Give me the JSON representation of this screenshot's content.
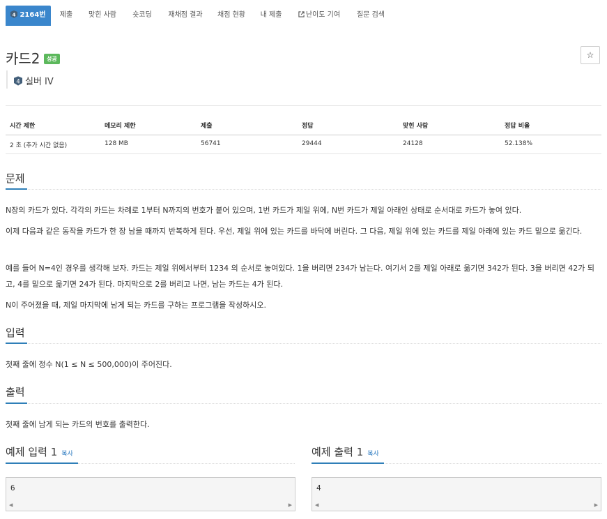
{
  "nav": {
    "problem_tab": "2164번",
    "tabs": [
      "제출",
      "맞힌 사람",
      "숏코딩",
      "재채점 결과",
      "채점 현황",
      "내 제출",
      "난이도 기여",
      "질문 검색"
    ]
  },
  "problem": {
    "title": "카드2",
    "status_badge": "성공",
    "star_icon": "☆",
    "tier": "실버 IV",
    "tier_number": "4"
  },
  "stats": {
    "headers": [
      "시간 제한",
      "메모리 제한",
      "제출",
      "정답",
      "맞힌 사람",
      "정답 비율"
    ],
    "values": [
      "2 초 (추가 시간 없음)",
      "128 MB",
      "56741",
      "29444",
      "24128",
      "52.138%"
    ]
  },
  "sections": {
    "problem_heading": "문제",
    "problem_p1": "N장의 카드가 있다. 각각의 카드는 차례로 1부터 N까지의 번호가 붙어 있으며, 1번 카드가 제일 위에, N번 카드가 제일 아래인 상태로 순서대로 카드가 놓여 있다.",
    "problem_p2": "이제 다음과 같은 동작을 카드가 한 장 남을 때까지 반복하게 된다. 우선, 제일 위에 있는 카드를 바닥에 버린다. 그 다음, 제일 위에 있는 카드를 제일 아래에 있는 카드 밑으로 옮긴다.",
    "problem_p3": "예를 들어 N=4인 경우를 생각해 보자. 카드는 제일 위에서부터 1234 의 순서로 놓여있다. 1을 버리면 234가 남는다. 여기서 2를 제일 아래로 옮기면 342가 된다. 3을 버리면 42가 되고, 4를 밑으로 옮기면 24가 된다. 마지막으로 2를 버리고 나면, 남는 카드는 4가 된다.",
    "problem_p4": "N이 주어졌을 때, 제일 마지막에 남게 되는 카드를 구하는 프로그램을 작성하시오.",
    "input_heading": "입력",
    "input_text": "첫째 줄에 정수 N(1 ≤ N ≤ 500,000)이 주어진다.",
    "output_heading": "출력",
    "output_text": "첫째 줄에 남게 되는 카드의 번호를 출력한다."
  },
  "examples": {
    "input_heading": "예제 입력 1",
    "output_heading": "예제 출력 1",
    "copy_label": "복사",
    "input_value": "6",
    "output_value": "4"
  }
}
